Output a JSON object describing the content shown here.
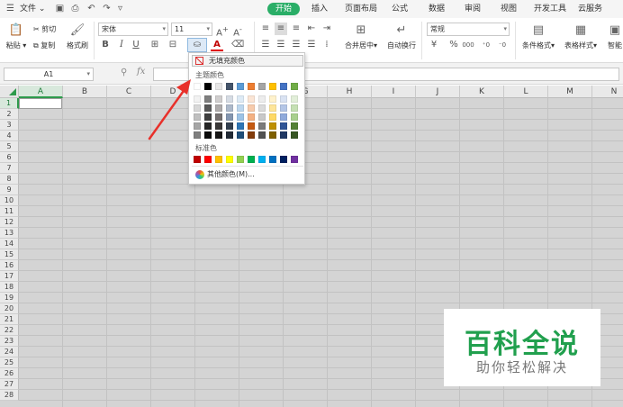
{
  "menubar": {
    "file_label": "文件",
    "tabs": [
      {
        "label": "开始",
        "active": true
      },
      {
        "label": "插入"
      },
      {
        "label": "页面布局"
      },
      {
        "label": "公式"
      },
      {
        "label": "数据"
      },
      {
        "label": "审阅"
      },
      {
        "label": "视图"
      },
      {
        "label": "开发工具"
      },
      {
        "label": "云服务"
      }
    ],
    "accent_color": "#2aae67"
  },
  "ribbon": {
    "paste_label": "粘贴",
    "cut_label": "剪切",
    "copy_label": "复制",
    "format_painter_label": "格式刷",
    "font_name": "宋体",
    "font_size": "11",
    "bold": "B",
    "italic": "I",
    "underline": "U",
    "font_color_letter": "A",
    "merge_center_label": "合并居中",
    "wrap_text_label": "自动换行",
    "number_format": "常规",
    "percent": "%",
    "thousands": "000",
    "conditional_format_label": "条件格式",
    "table_style_label": "表格样式",
    "smart_label": "智能"
  },
  "formula_bar": {
    "name_box": "A1",
    "fx_label": "fx",
    "formula": ""
  },
  "grid": {
    "columns": [
      "A",
      "B",
      "C",
      "D",
      "E",
      "F",
      "G",
      "H",
      "I",
      "J",
      "K",
      "L",
      "M",
      "N"
    ],
    "rows": [
      "1",
      "2",
      "3",
      "4",
      "5",
      "6",
      "7",
      "8",
      "9",
      "10",
      "11",
      "12",
      "13",
      "14",
      "15",
      "16",
      "17",
      "18",
      "19",
      "20",
      "21",
      "22",
      "23",
      "24",
      "25",
      "26",
      "27",
      "28"
    ],
    "selected_cell": "A1"
  },
  "color_picker": {
    "no_fill_label": "无填充颜色",
    "theme_colors_label": "主题颜色",
    "standard_colors_label": "标准色",
    "more_colors_label": "其他颜色(M)...",
    "theme_top_row": [
      "#ffffff",
      "#000000",
      "#e7e6e6",
      "#44546a",
      "#5b9bd5",
      "#ed7d31",
      "#a5a5a5",
      "#ffc000",
      "#4472c4",
      "#70ad47"
    ],
    "theme_shades": [
      [
        "#f2f2f2",
        "#7f7f7f",
        "#d0cece",
        "#d6dce4",
        "#deebf6",
        "#fbe5d5",
        "#ededed",
        "#fff2cc",
        "#dae3f3",
        "#e2efd9"
      ],
      [
        "#d8d8d8",
        "#595959",
        "#aeabab",
        "#adb9ca",
        "#bdd7ee",
        "#f7cbac",
        "#dbdbdb",
        "#fee599",
        "#b4c6e7",
        "#c5e0b3"
      ],
      [
        "#bfbfbf",
        "#3f3f3f",
        "#757070",
        "#8496b0",
        "#9dc3e6",
        "#f4b183",
        "#c9c9c9",
        "#ffd965",
        "#8faadc",
        "#a8d08d"
      ],
      [
        "#a5a5a5",
        "#262626",
        "#3a3838",
        "#323f4f",
        "#2e75b5",
        "#c55a11",
        "#7b7b7b",
        "#bf9000",
        "#2f5597",
        "#538135"
      ],
      [
        "#7f7f7f",
        "#0c0c0c",
        "#171616",
        "#222a35",
        "#1e4e79",
        "#833c0b",
        "#525252",
        "#7f6000",
        "#1f3864",
        "#375623"
      ]
    ],
    "standard_colors": [
      "#c00000",
      "#ff0000",
      "#ffc000",
      "#ffff00",
      "#92d050",
      "#00b050",
      "#00b0f0",
      "#0070c0",
      "#002060",
      "#7030a0"
    ]
  },
  "watermark": {
    "title": "百科全说",
    "subtitle": "助你轻松解决",
    "color": "#21a04e"
  }
}
